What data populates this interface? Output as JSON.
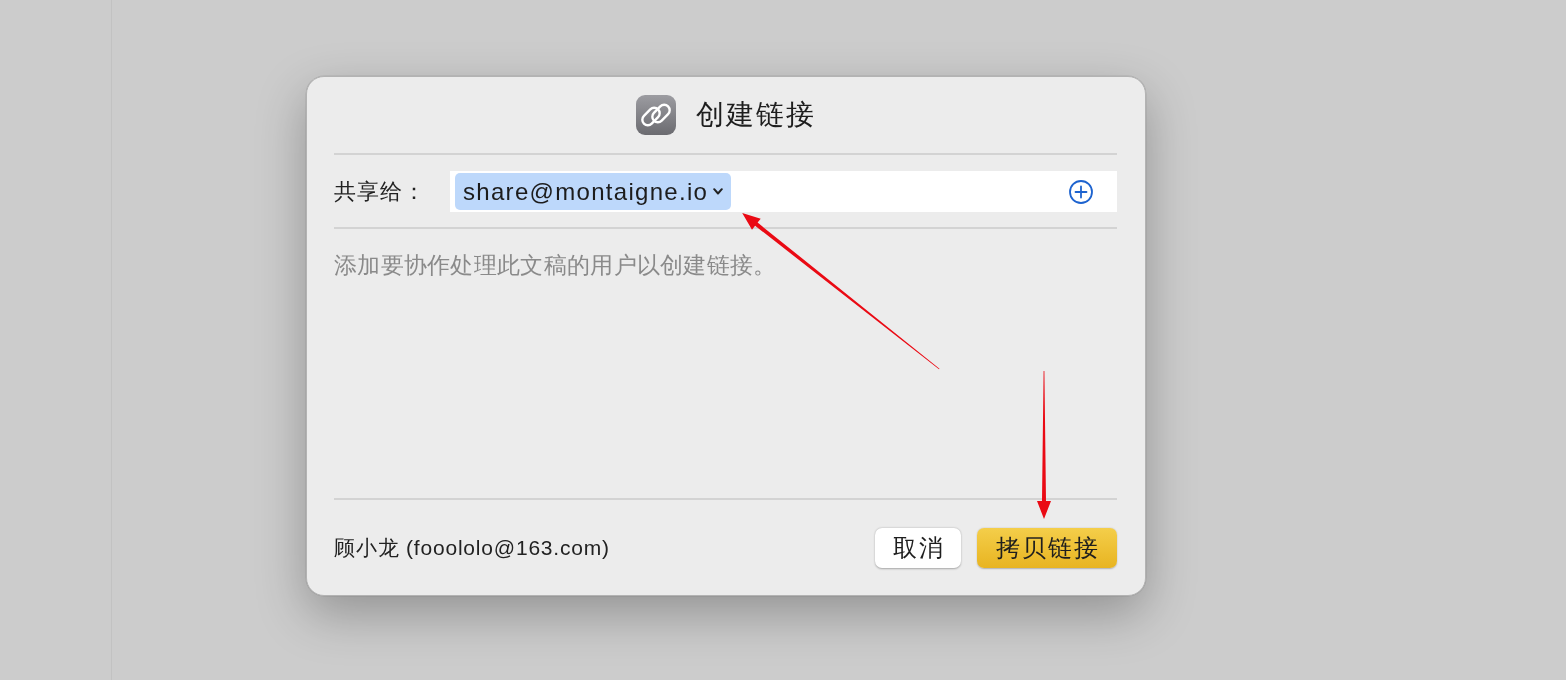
{
  "window": {
    "title": "创建链接"
  },
  "share_row": {
    "label": "共享给：",
    "recipients": [
      {
        "address": "share@montaigne.io",
        "arrow": true
      }
    ]
  },
  "hint": "添加要协作处理此文稿的用户以创建链接。",
  "footer": {
    "owner": "顾小龙 (fooololo@163.com)",
    "buttons": [
      {
        "label": "取消",
        "kind": "secondary"
      },
      {
        "label": "拷贝链接",
        "kind": "primary",
        "arrow": true
      }
    ]
  }
}
